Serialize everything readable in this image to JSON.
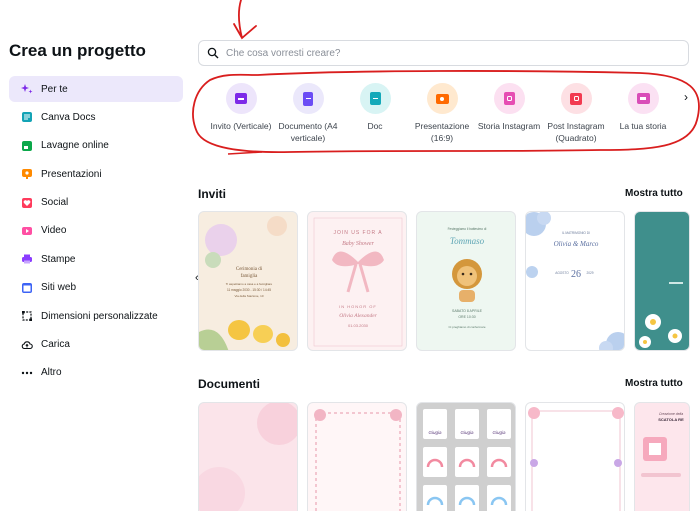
{
  "sidebar": {
    "title": "Crea un progetto",
    "items": [
      {
        "label": "Per te",
        "icon": "sparkle-icon",
        "color": "#7d2ae8",
        "active": true
      },
      {
        "label": "Canva Docs",
        "icon": "docs-icon",
        "color": "#13a3b5"
      },
      {
        "label": "Lavagne online",
        "icon": "whiteboard-icon",
        "color": "#0ba84a"
      },
      {
        "label": "Presentazioni",
        "icon": "presentation-icon",
        "color": "#ff8a00"
      },
      {
        "label": "Social",
        "icon": "heart-icon",
        "color": "#ff3b5c"
      },
      {
        "label": "Video",
        "icon": "video-icon",
        "color": "#ff4fa3"
      },
      {
        "label": "Stampe",
        "icon": "print-icon",
        "color": "#8b3dff"
      },
      {
        "label": "Siti web",
        "icon": "website-icon",
        "color": "#3c63f5"
      },
      {
        "label": "Dimensioni personalizzate",
        "icon": "resize-icon",
        "color": "#0d1216"
      },
      {
        "label": "Carica",
        "icon": "cloud-upload-icon",
        "color": "#0d1216"
      },
      {
        "label": "Altro",
        "icon": "more-icon",
        "color": "#0d1216"
      }
    ]
  },
  "search": {
    "placeholder": "Che cosa vorresti creare?"
  },
  "categories": [
    {
      "label": "Invito (Verticale)",
      "bg": "#ede5fb",
      "fg": "#7d2ae8",
      "icon": "invitation-icon"
    },
    {
      "label": "Documento (A4 verticale)",
      "bg": "#ebe8fb",
      "fg": "#6b4cf5",
      "icon": "document-icon"
    },
    {
      "label": "Doc",
      "bg": "#d8f4f4",
      "fg": "#14a9b9",
      "icon": "doc-icon"
    },
    {
      "label": "Presentazione (16:9)",
      "bg": "#ffe9cf",
      "fg": "#ff6a00",
      "icon": "presentation-icon"
    },
    {
      "label": "Storia Instagram",
      "bg": "#fce0f1",
      "fg": "#e64db3",
      "icon": "instagram-story-icon"
    },
    {
      "label": "Post Instagram (Quadrato)",
      "bg": "#fde0e4",
      "fg": "#f23a50",
      "icon": "instagram-post-icon"
    },
    {
      "label": "La tua storia",
      "bg": "#fbe1f3",
      "fg": "#d94db8",
      "icon": "story-icon"
    }
  ],
  "sections": {
    "invites": {
      "title": "Inviti",
      "link": "Mostra tutto"
    },
    "documents": {
      "title": "Documenti",
      "link": "Mostra tutto"
    }
  },
  "invite_cards": [
    {
      "lines": [
        "Cerimonia di",
        "famiglia",
        "Ti aspettiamo a casa e a famigliare",
        "11 maggio 2030 - 15:30 / 14:45",
        "Via della Stazione, 10"
      ]
    },
    {
      "lines": [
        "JOIN US FOR A",
        "Baby Shower",
        "IN HONOR OF",
        "Olivia Alexander",
        "01.03.2030"
      ]
    },
    {
      "lines": [
        "Festeggiamo il battesimo di",
        "Tommaso",
        "SABATO 8 APRILE",
        "ORE 10:30",
        "Ci preghiamo di confermare"
      ]
    },
    {
      "lines": [
        "IL MATRIMONIO DI",
        "Olivia & Marco",
        "AGOSTO",
        "26",
        "2029"
      ]
    },
    {
      "lines": []
    }
  ],
  "document_cards": [
    {
      "lines": []
    },
    {
      "lines": []
    },
    {
      "lines": [
        "Giugia",
        "Giugia",
        "Giugia"
      ]
    },
    {
      "lines": []
    },
    {
      "lines": [
        "Creazione della",
        "SCATOLA RE"
      ]
    }
  ],
  "annotation_color": "#d91e1e"
}
